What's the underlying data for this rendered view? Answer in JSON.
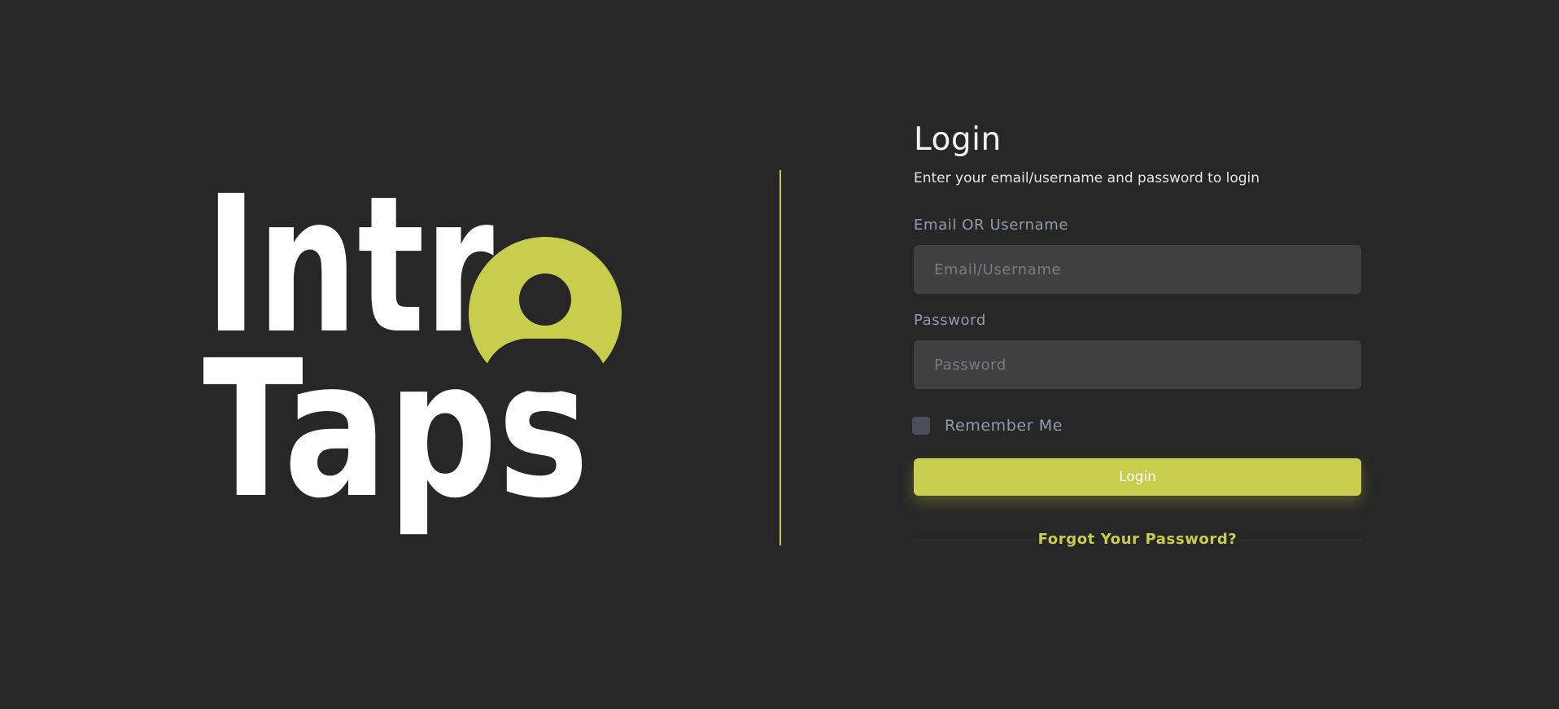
{
  "brand": {
    "word_top": "Intr",
    "word_bottom": "Taps",
    "text_color": "#ffffff",
    "accent_color": "#c9cd4d",
    "icon": "user-circle-icon"
  },
  "login": {
    "title": "Login",
    "subtitle": "Enter your email/username and password to login",
    "email_label": "Email OR Username",
    "email_placeholder": "Email/Username",
    "password_label": "Password",
    "password_placeholder": "Password",
    "remember_label": "Remember Me",
    "remember_checked": false,
    "submit_label": "Login",
    "forgot_label": "Forgot Your Password?"
  },
  "colors": {
    "background": "#272727",
    "input_background": "#404040",
    "label": "#9699ad",
    "accent": "#c9cd4d"
  }
}
